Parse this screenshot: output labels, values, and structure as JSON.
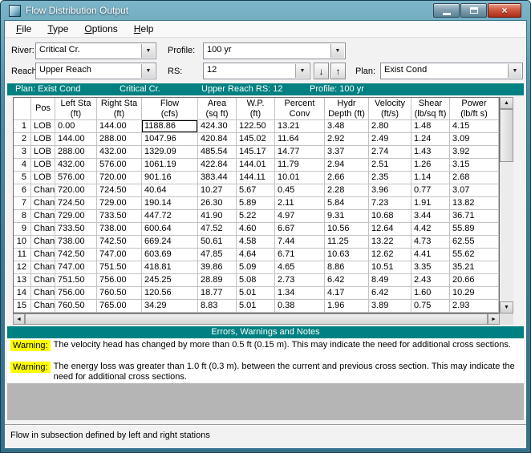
{
  "window": {
    "title": "Flow Distribution Output"
  },
  "titlebar_icons": {
    "close_glyph": "×"
  },
  "menu": [
    {
      "u": "F",
      "rest": "ile"
    },
    {
      "u": "T",
      "rest": "ype"
    },
    {
      "u": "O",
      "rest": "ptions"
    },
    {
      "u": "H",
      "rest": "elp"
    }
  ],
  "selectors": {
    "river_label": "River:",
    "river_value": "Critical Cr.",
    "profile_label": "Profile:",
    "profile_value": "100 yr",
    "reach_label": "Reach",
    "reach_value": "Upper Reach",
    "rs_label": "RS:",
    "rs_value": "12",
    "plan_label": "Plan:",
    "plan_value": "Exist Cond"
  },
  "icons": {
    "dropdown": "▼",
    "scroll_up": "▲",
    "scroll_down": "▼",
    "scroll_left": "◄",
    "scroll_right": "►",
    "rs_down": "↓",
    "rs_up": "↑"
  },
  "info_bar": {
    "plan": "Plan: Exist Cond",
    "river": "Critical Cr.",
    "reach_rs": "Upper Reach  RS: 12",
    "profile": "Profile: 100 yr"
  },
  "table": {
    "columns": [
      {
        "line1": "",
        "line2": ""
      },
      {
        "line1": "Pos",
        "line2": ""
      },
      {
        "line1": "Left Sta",
        "line2": "(ft)"
      },
      {
        "line1": "Right Sta",
        "line2": "(ft)"
      },
      {
        "line1": "Flow",
        "line2": "(cfs)"
      },
      {
        "line1": "Area",
        "line2": "(sq ft)"
      },
      {
        "line1": "W.P.",
        "line2": "(ft)"
      },
      {
        "line1": "Percent",
        "line2": "Conv"
      },
      {
        "line1": "Hydr",
        "line2": "Depth (ft)"
      },
      {
        "line1": "Velocity",
        "line2": "(ft/s)"
      },
      {
        "line1": "Shear",
        "line2": "(lb/sq ft)"
      },
      {
        "line1": "Power",
        "line2": "(lb/ft s)"
      }
    ],
    "selected_cell": {
      "row": 0,
      "col": 4
    },
    "rows": [
      [
        "1",
        "LOB",
        "0.00",
        "144.00",
        "1188.86",
        "424.30",
        "122.50",
        "13.21",
        "3.48",
        "2.80",
        "1.48",
        "4.15"
      ],
      [
        "2",
        "LOB",
        "144.00",
        "288.00",
        "1047.96",
        "420.84",
        "145.02",
        "11.64",
        "2.92",
        "2.49",
        "1.24",
        "3.09"
      ],
      [
        "3",
        "LOB",
        "288.00",
        "432.00",
        "1329.09",
        "485.54",
        "145.17",
        "14.77",
        "3.37",
        "2.74",
        "1.43",
        "3.92"
      ],
      [
        "4",
        "LOB",
        "432.00",
        "576.00",
        "1061.19",
        "422.84",
        "144.01",
        "11.79",
        "2.94",
        "2.51",
        "1.26",
        "3.15"
      ],
      [
        "5",
        "LOB",
        "576.00",
        "720.00",
        "901.16",
        "383.44",
        "144.11",
        "10.01",
        "2.66",
        "2.35",
        "1.14",
        "2.68"
      ],
      [
        "6",
        "Chan",
        "720.00",
        "724.50",
        "40.64",
        "10.27",
        "5.67",
        "0.45",
        "2.28",
        "3.96",
        "0.77",
        "3.07"
      ],
      [
        "7",
        "Chan",
        "724.50",
        "729.00",
        "190.14",
        "26.30",
        "5.89",
        "2.11",
        "5.84",
        "7.23",
        "1.91",
        "13.82"
      ],
      [
        "8",
        "Chan",
        "729.00",
        "733.50",
        "447.72",
        "41.90",
        "5.22",
        "4.97",
        "9.31",
        "10.68",
        "3.44",
        "36.71"
      ],
      [
        "9",
        "Chan",
        "733.50",
        "738.00",
        "600.64",
        "47.52",
        "4.60",
        "6.67",
        "10.56",
        "12.64",
        "4.42",
        "55.89"
      ],
      [
        "10",
        "Chan",
        "738.00",
        "742.50",
        "669.24",
        "50.61",
        "4.58",
        "7.44",
        "11.25",
        "13.22",
        "4.73",
        "62.55"
      ],
      [
        "11",
        "Chan",
        "742.50",
        "747.00",
        "603.69",
        "47.85",
        "4.64",
        "6.71",
        "10.63",
        "12.62",
        "4.41",
        "55.62"
      ],
      [
        "12",
        "Chan",
        "747.00",
        "751.50",
        "418.81",
        "39.86",
        "5.09",
        "4.65",
        "8.86",
        "10.51",
        "3.35",
        "35.21"
      ],
      [
        "13",
        "Chan",
        "751.50",
        "756.00",
        "245.25",
        "28.89",
        "5.08",
        "2.73",
        "6.42",
        "8.49",
        "2.43",
        "20.66"
      ],
      [
        "14",
        "Chan",
        "756.00",
        "760.50",
        "120.56",
        "18.77",
        "5.01",
        "1.34",
        "4.17",
        "6.42",
        "1.60",
        "10.29"
      ],
      [
        "15",
        "Chan",
        "760.50",
        "765.00",
        "34.29",
        "8.83",
        "5.01",
        "0.38",
        "1.96",
        "3.89",
        "0.75",
        "2.93"
      ]
    ]
  },
  "errors_section": {
    "title": "Errors, Warnings and Notes"
  },
  "warnings": [
    {
      "label": "Warning:",
      "text": "The velocity head has changed by more than 0.5 ft (0.15 m).  This may indicate the need for additional cross sections."
    },
    {
      "label": "Warning:",
      "text": "The energy loss was greater than 1.0 ft (0.3 m). between the current and previous cross section.  This may indicate the need for additional cross sections."
    }
  ],
  "status_bar": {
    "text": "Flow in subsection defined by left and right stations"
  },
  "colors": {
    "teal": "#008080",
    "warning_yellow": "#ffff00"
  }
}
